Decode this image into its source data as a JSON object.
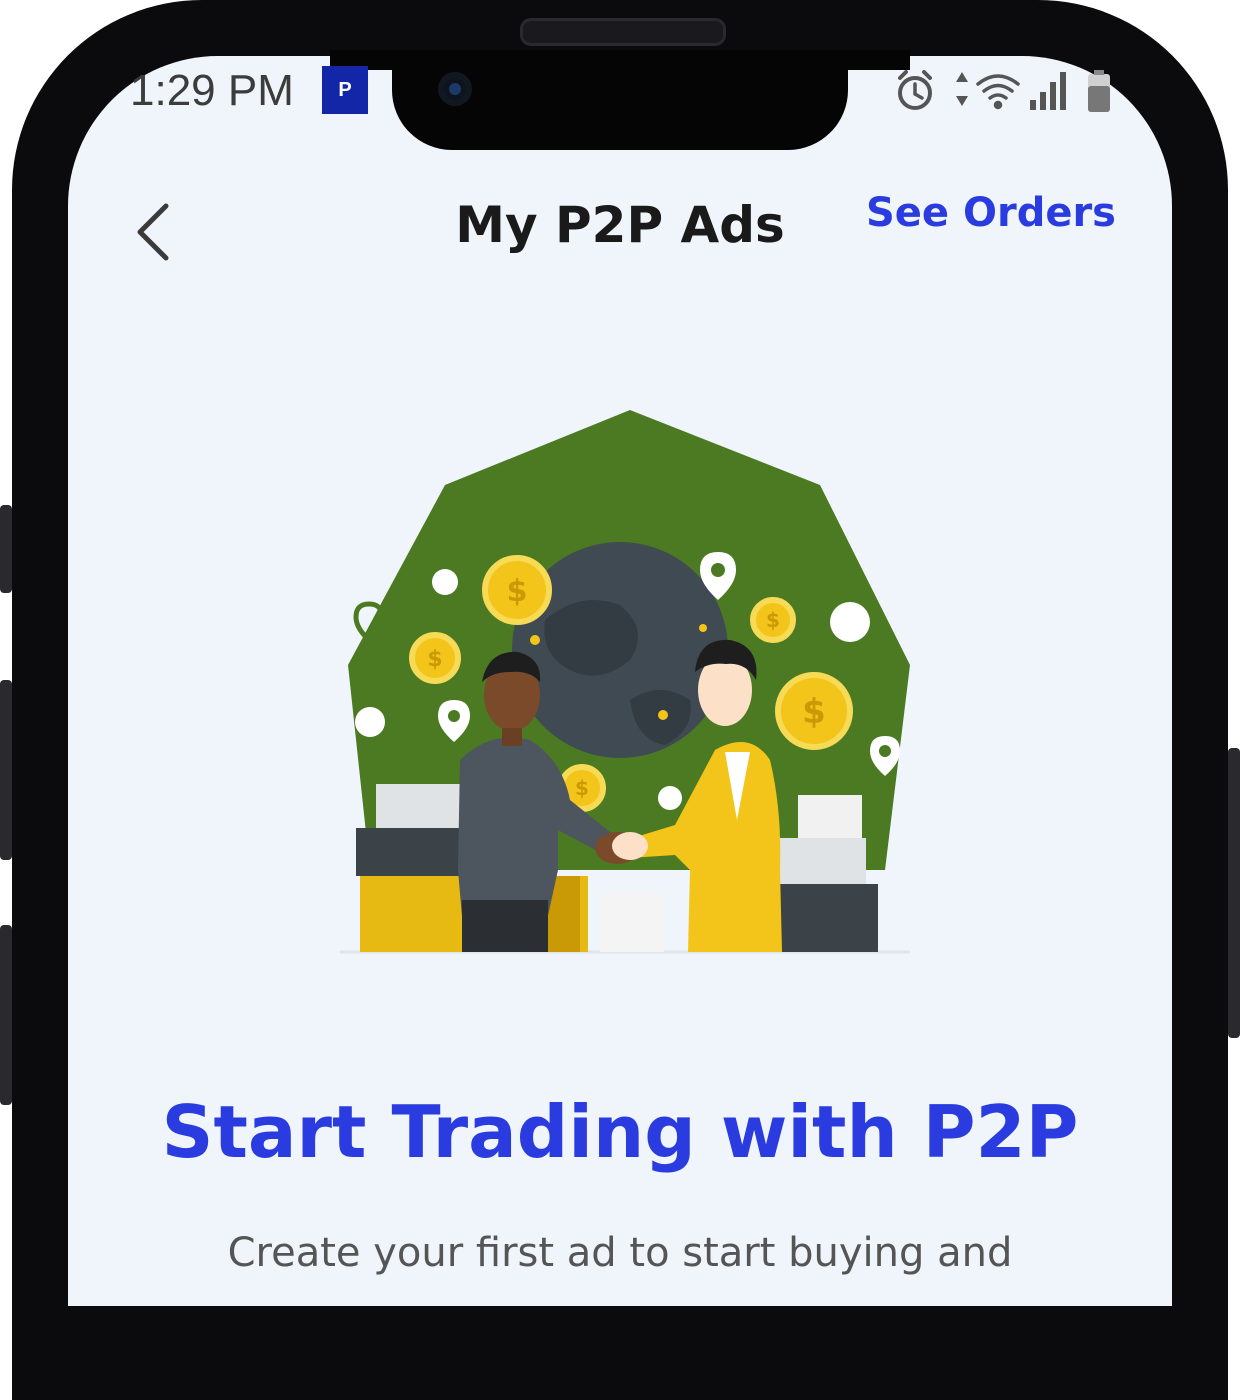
{
  "status_bar": {
    "time": "1:29 PM",
    "app_badge": "P"
  },
  "header": {
    "title": "My P2P Ads",
    "see_orders_label": "See Orders"
  },
  "empty_state": {
    "headline": "Start Trading with P2P",
    "description": "Create your first ad to start buying and"
  },
  "icons": {
    "back": "chevron-left-icon",
    "alarm": "alarm-icon",
    "data": "data-arrows-icon",
    "wifi": "wifi-icon",
    "signal": "signal-icon",
    "battery": "battery-icon"
  },
  "colors": {
    "accent": "#2a3be0",
    "screen_bg": "#eff5fa",
    "illustration_green": "#4b7a22",
    "coin_yellow": "#f3c51a"
  }
}
